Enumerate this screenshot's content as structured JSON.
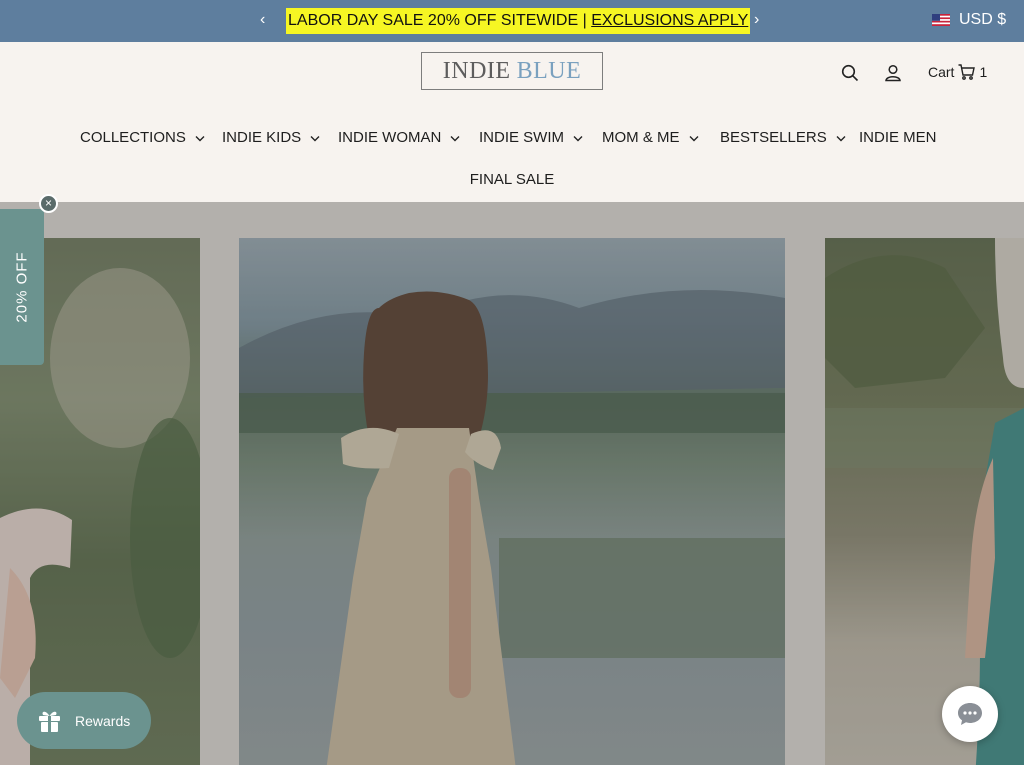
{
  "announcement": {
    "prev_icon": "chevron-left-icon",
    "next_icon": "chevron-right-icon",
    "prev_glyph": "‹",
    "next_glyph": "›",
    "text": "LABOR DAY SALE 20% OFF SITEWIDE | ",
    "link": "EXCLUSIONS APPLY",
    "background": "#5e7e9e",
    "highlight": "#f6f623"
  },
  "currency": {
    "label": "USD $",
    "flag_icon": "us-flag-icon"
  },
  "header": {
    "logo_word1": "INDIE",
    "logo_word2": "BLUE",
    "search_icon": "search-icon",
    "account_icon": "user-icon",
    "cart_label": "Cart",
    "cart_icon": "cart-icon",
    "cart_count": "1"
  },
  "nav": {
    "items": [
      {
        "label": "COLLECTIONS",
        "has_dropdown": true
      },
      {
        "label": "INDIE KIDS",
        "has_dropdown": true
      },
      {
        "label": "INDIE WOMAN",
        "has_dropdown": true
      },
      {
        "label": "INDIE SWIM",
        "has_dropdown": true
      },
      {
        "label": "MOM & ME",
        "has_dropdown": true
      },
      {
        "label": "BESTSELLERS",
        "has_dropdown": true
      },
      {
        "label": "INDIE MEN",
        "has_dropdown": false
      },
      {
        "label": "FINAL SALE",
        "has_dropdown": false
      }
    ]
  },
  "side_tab": {
    "label": "20% OFF",
    "close_glyph": "×",
    "color": "#6b938f"
  },
  "rewards": {
    "label": "Rewards",
    "icon": "gift-icon"
  },
  "chat": {
    "icon": "chat-bubble-icon"
  }
}
